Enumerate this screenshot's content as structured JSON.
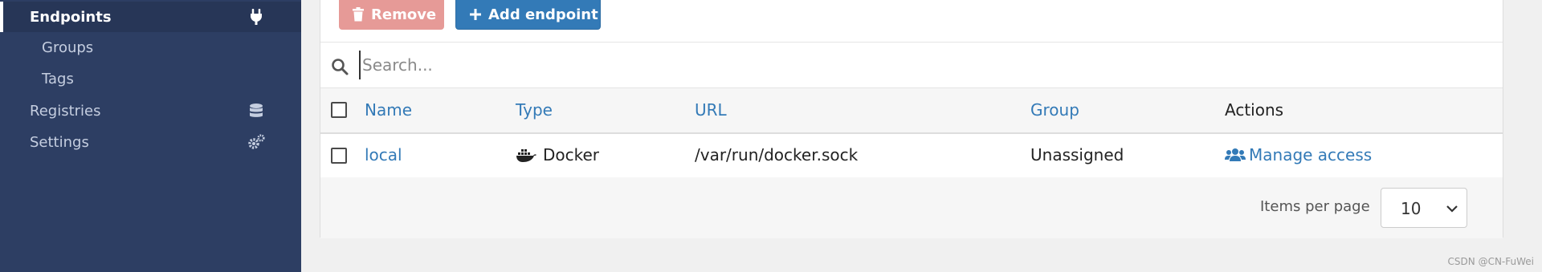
{
  "sidebar": {
    "items": [
      {
        "label": "Endpoints",
        "icon": "plug-icon"
      },
      {
        "label": "Groups"
      },
      {
        "label": "Tags"
      },
      {
        "label": "Registries",
        "icon": "database-icon"
      },
      {
        "label": "Settings",
        "icon": "cogs-icon"
      }
    ]
  },
  "toolbar": {
    "remove_label": "Remove",
    "add_label": "Add endpoint"
  },
  "search": {
    "placeholder": "Search..."
  },
  "table": {
    "columns": [
      "Name",
      "Type",
      "URL",
      "Group",
      "Actions"
    ],
    "rows": [
      {
        "name": "local",
        "type": "Docker",
        "url": "/var/run/docker.sock",
        "group": "Unassigned",
        "action": "Manage access"
      }
    ]
  },
  "footer": {
    "items_per_page_label": "Items per page",
    "items_per_page_value": "10"
  },
  "watermark": "CSDN @CN-FuWei",
  "colors": {
    "sidebar_bg": "#2d3e63",
    "accent": "#337ab7",
    "danger_disabled": "#e69a97"
  }
}
